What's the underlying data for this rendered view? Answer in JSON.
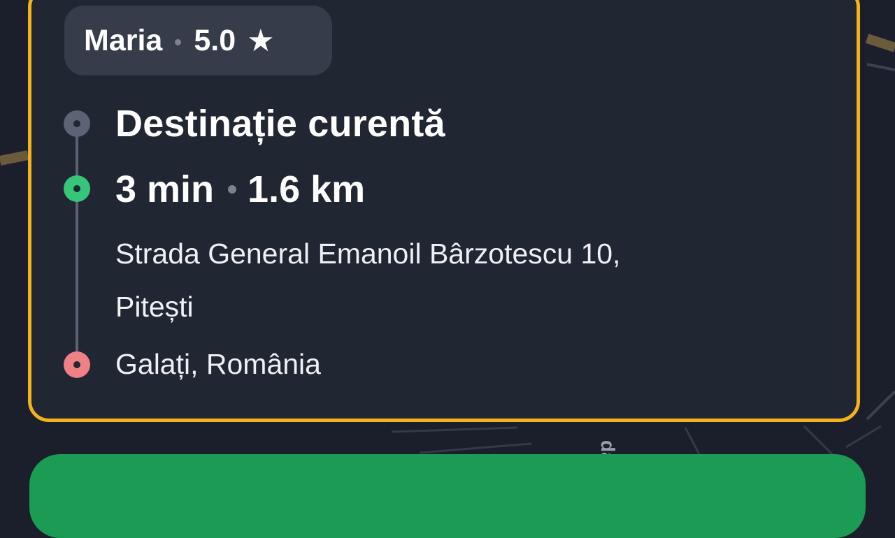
{
  "driver": {
    "name": "Maria",
    "rating": "5.0",
    "star": "★"
  },
  "route": {
    "current_label": "Destinație curentă",
    "eta_time": "3 min",
    "eta_distance": "1.6 km",
    "pickup_address_line1": "Strada General Emanoil Bârzotescu 10,",
    "pickup_address_line2": "Pitești",
    "destination": "Galați, România"
  },
  "map": {
    "street_fragment": "da"
  },
  "colors": {
    "card_border": "#f4b21a",
    "card_bg": "#212633",
    "pickup_node": "#35c67a",
    "destination_node": "#f07f86",
    "action_button": "#1b9b53"
  },
  "icons": [
    "star-icon",
    "route-node-icon",
    "pickup-node-icon",
    "destination-node-icon"
  ]
}
